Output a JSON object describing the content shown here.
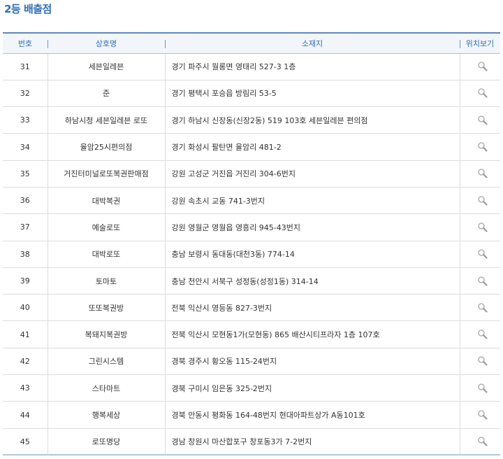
{
  "page": {
    "title": "2등 배출점"
  },
  "icons": {
    "map_view": "magnifier-icon"
  },
  "colors": {
    "title": "#2e6fb4",
    "header_text": "#2e6fb4",
    "header_rule": "#5d86bd"
  },
  "table": {
    "headers": {
      "no": "번호",
      "name": "상호명",
      "address": "소재지",
      "map": "위치보기"
    },
    "rows": [
      {
        "no": "31",
        "name": "세븐일레븐",
        "address": "경기 파주시 월롱면 영태리 527-3 1층"
      },
      {
        "no": "32",
        "name": "준",
        "address": "경기 평택시 포승읍 방림리 53-5"
      },
      {
        "no": "33",
        "name": "하남시청 세븐일레븐 로또",
        "address": "경기 하남시 신장동(신장2동) 519 103호 세븐일레븐 편의점"
      },
      {
        "no": "34",
        "name": "율암25시편의점",
        "address": "경기 화성시 팔탄면 율암리 481-2"
      },
      {
        "no": "35",
        "name": "거진터미널로또복권판매점",
        "address": "강원 고성군 거진읍 거진리 304-6번지"
      },
      {
        "no": "36",
        "name": "대박복권",
        "address": "강원 속초시 교동 741-3번지"
      },
      {
        "no": "37",
        "name": "예술로또",
        "address": "강원 영월군 영월읍 영흥리 945-43번지"
      },
      {
        "no": "38",
        "name": "대박로또",
        "address": "충남 보령시 동대동(대천3동) 774-14"
      },
      {
        "no": "39",
        "name": "토마토",
        "address": "충남 천안시 서북구 성정동(성정1동) 314-14"
      },
      {
        "no": "40",
        "name": "또또복권방",
        "address": "전북 익산시 영등동 827-3번지"
      },
      {
        "no": "41",
        "name": "복돼지복권방",
        "address": "전북 익산시 모현동1가(모현동) 865 배산시티프라자 1층 107호"
      },
      {
        "no": "42",
        "name": "그린시스템",
        "address": "경북 경주시 황오동 115-24번지"
      },
      {
        "no": "43",
        "name": "스타마트",
        "address": "경북 구미시 임은동 325-2번지"
      },
      {
        "no": "44",
        "name": "행복세상",
        "address": "경북 안동시 평화동 164-48번지 현대아파트상가 A동101호"
      },
      {
        "no": "45",
        "name": "로또명당",
        "address": "경남 창원시 마산합포구 창포동3가 7-2번지"
      }
    ]
  }
}
